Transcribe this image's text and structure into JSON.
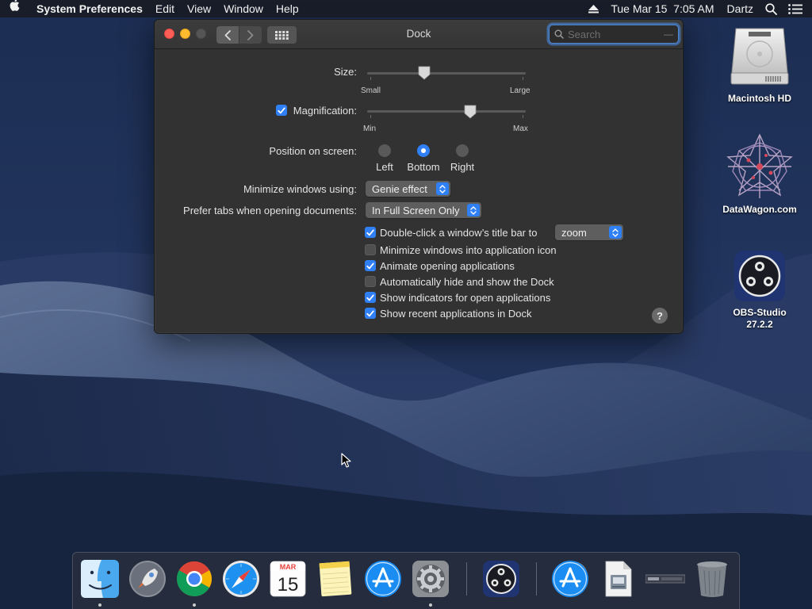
{
  "menubar": {
    "app_name": "System Preferences",
    "menus": [
      "Edit",
      "View",
      "Window",
      "Help"
    ],
    "clock": "Tue Mar 15  7:05 AM",
    "user": "Dartz"
  },
  "window": {
    "title": "Dock",
    "search_placeholder": "Search"
  },
  "dock_prefs": {
    "size_label": "Size:",
    "size_min": "Small",
    "size_max": "Large",
    "size_value": 0.36,
    "magnification_label": "Magnification:",
    "magnification_checked": true,
    "magnification_min": "Min",
    "magnification_max": "Max",
    "magnification_value": 0.65,
    "position_label": "Position on screen:",
    "positions": [
      "Left",
      "Bottom",
      "Right"
    ],
    "position_selected": "Bottom",
    "minimize_label": "Minimize windows using:",
    "minimize_value": "Genie effect",
    "prefer_tabs_label": "Prefer tabs when opening documents:",
    "prefer_tabs_value": "In Full Screen Only",
    "double_click_label": "Double-click a window’s title bar to",
    "double_click_value": "zoom",
    "options": [
      {
        "label": "Double-click a window’s title bar to",
        "checked": true
      },
      {
        "label": "Minimize windows into application icon",
        "checked": false
      },
      {
        "label": "Animate opening applications",
        "checked": true
      },
      {
        "label": "Automatically hide and show the Dock",
        "checked": false
      },
      {
        "label": "Show indicators for open applications",
        "checked": true
      },
      {
        "label": "Show recent applications in Dock",
        "checked": true
      }
    ],
    "help": "?"
  },
  "desktop": {
    "icons": [
      {
        "label": "Macintosh HD",
        "icon": "hard-drive-icon"
      },
      {
        "label": "DataWagon.com",
        "icon": "datawagon-icon"
      },
      {
        "label_line1": "OBS-Studio",
        "label_line2": "27.2.2",
        "icon": "obs-icon"
      }
    ]
  },
  "dock": {
    "apps": [
      {
        "name": "Finder",
        "running": true
      },
      {
        "name": "Launchpad",
        "running": false
      },
      {
        "name": "Google Chrome",
        "running": true
      },
      {
        "name": "Safari",
        "running": false
      },
      {
        "name": "Calendar",
        "running": false,
        "month": "MAR",
        "day": "15"
      },
      {
        "name": "Notes",
        "running": false
      },
      {
        "name": "App Store",
        "running": false
      },
      {
        "name": "System Preferences",
        "running": true
      },
      {
        "name": "OBS Studio",
        "running": false
      },
      {
        "name": "App Store Downloads",
        "running": false
      },
      {
        "name": "Document",
        "running": false
      },
      {
        "name": "Screenshot",
        "running": false
      },
      {
        "name": "Trash",
        "running": false
      }
    ]
  },
  "colors": {
    "accent": "#2f7ff5",
    "window_bg": "#323232",
    "close": "#fd5f57",
    "minimize": "#febb2e"
  }
}
